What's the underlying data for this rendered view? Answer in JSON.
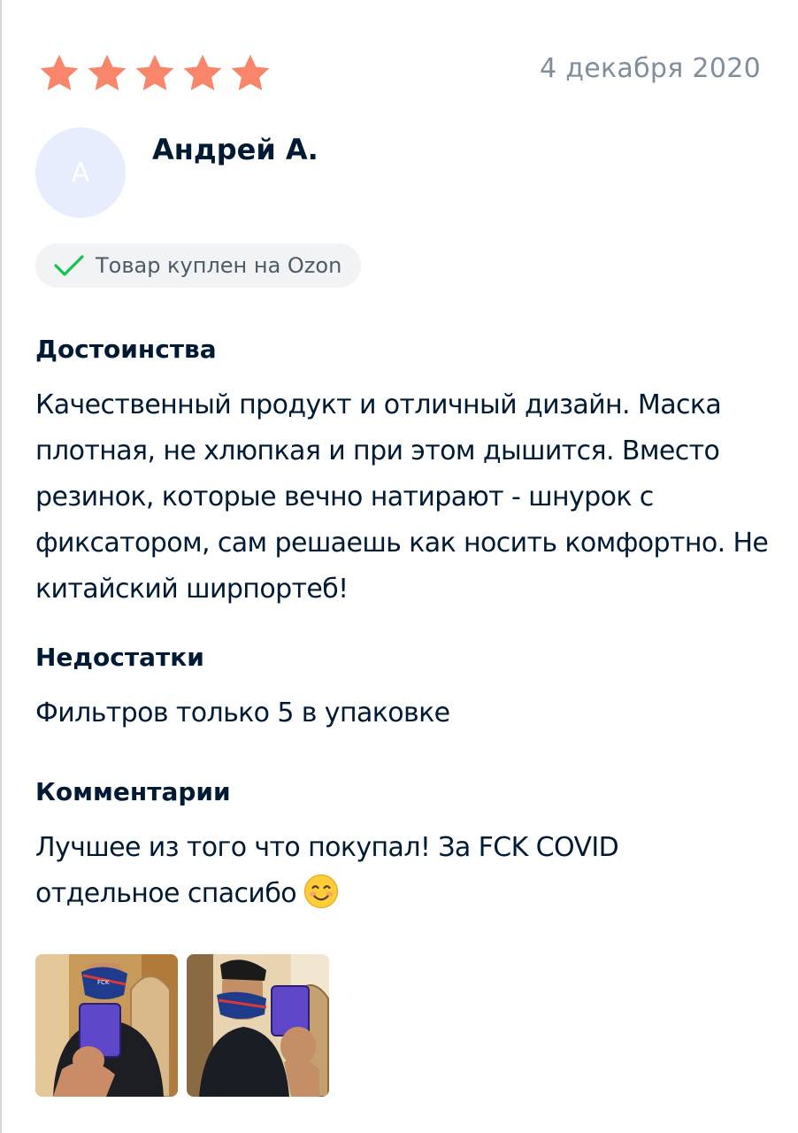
{
  "review": {
    "rating": 5,
    "rating_max": 5,
    "date": "4 декабря 2020",
    "author": {
      "initial": "А",
      "name": "Андрей А."
    },
    "badge": {
      "label": "Товар куплен на Ozon",
      "icon": "check-icon"
    },
    "pros": {
      "title": "Достоинства",
      "text": "Качественный продукт и отличный дизайн. Маска плотная, не хлюпкая и при этом дышится. Вместо резинок, которые вечно натирают - шнурок с фиксатором, сам решаешь как носить комфортно. Не китайский ширпортеб!"
    },
    "cons": {
      "title": "Недостатки",
      "text": "Фильтров только 5 в упаковке"
    },
    "comment": {
      "title": "Комментарии",
      "text": "Лучшее из того что покупал! За FCK COVID отдельное спасибо",
      "emoji": "smiling-face-icon"
    },
    "photos": [
      {
        "name": "review-photo-1"
      },
      {
        "name": "review-photo-2"
      }
    ]
  },
  "colors": {
    "star": "#f9866b",
    "check": "#10c44c",
    "text_primary": "#001a34",
    "text_secondary": "#808d9a",
    "avatar_bg": "#e7edfd",
    "badge_bg": "#f2f3f5"
  }
}
